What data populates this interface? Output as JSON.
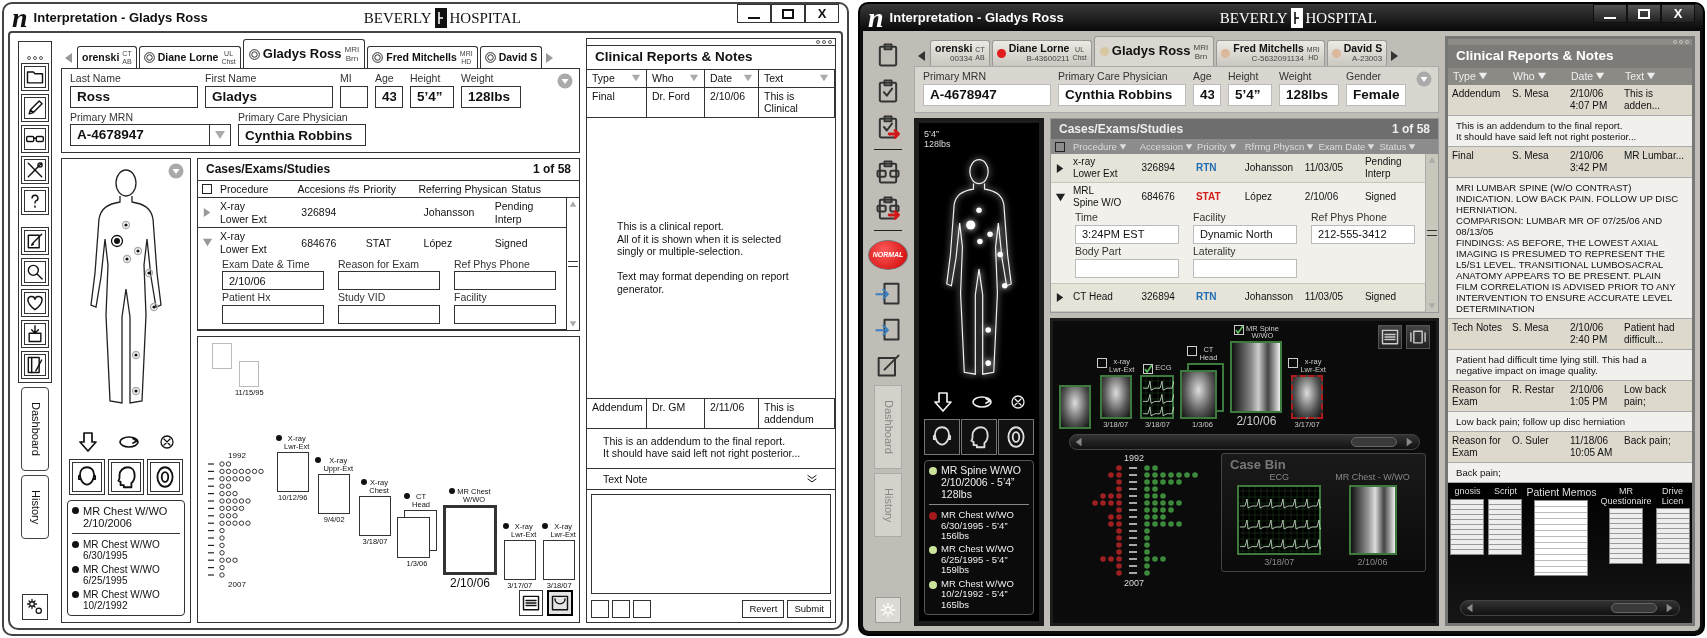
{
  "windows": [
    {
      "kind": "wireframe",
      "logo": "n",
      "title": "Interpretation - Gladys Ross",
      "brand": [
        "BEVERLY",
        "HOSPITAL"
      ],
      "close_label": "X",
      "toolbar": {
        "sidebar_tabs": [
          {
            "label": "Dashboard",
            "selected": false
          },
          {
            "label": "History",
            "selected": false
          }
        ]
      },
      "patient_tabs": [
        {
          "name": "orenski",
          "modality": "CT",
          "region": "AB",
          "selected": false
        },
        {
          "name": "Diane Lorne",
          "modality": "UL",
          "region": "Chst",
          "radio": true,
          "selected": false
        },
        {
          "name": "Gladys Ross",
          "modality": "MRI",
          "region": "Brn",
          "radio": true,
          "selected": true
        },
        {
          "name": "Fred Mitchells",
          "modality": "MRI",
          "region": "HD",
          "radio": true,
          "selected": false
        },
        {
          "name": "David S",
          "radio": true,
          "selected": false
        }
      ],
      "demographics": [
        [
          {
            "label": "Last Name",
            "value": "Ross",
            "kind": "text"
          },
          {
            "label": "First Name",
            "value": "Gladys",
            "kind": "text"
          },
          {
            "label": "MI",
            "kind": "short"
          },
          {
            "label": "Age",
            "value": "43",
            "kind": "short"
          },
          {
            "label": "Height",
            "value": "5’4”",
            "kind": "short"
          },
          {
            "label": "Weight",
            "value": "128lbs",
            "kind": "short"
          }
        ],
        [
          {
            "label": "Primary MRN",
            "value": "A-4678947",
            "kind": "dropdown"
          },
          {
            "label": "Primary Care Physician",
            "value": "Cynthia Robbins",
            "kind": "text"
          }
        ]
      ],
      "body_panel": {
        "studies": [
          {
            "title": "MR Chest W/WO",
            "detail": "2/10/2006",
            "current": true
          },
          {
            "title": "MR Chest W/WO",
            "detail": "6/30/1995",
            "current": false
          },
          {
            "title": "MR Chest W/WO",
            "detail": "6/25/1995",
            "current": false
          },
          {
            "title": "MR Chest W/WO",
            "detail": "10/2/1992",
            "current": false
          }
        ]
      },
      "cases": {
        "title": "Cases/Exams/Studies",
        "count": "1 of 58",
        "select_all": false,
        "columns": [
          {
            "label": "Procedure"
          },
          {
            "label": "Accesions #s"
          },
          {
            "label": "Priority"
          },
          {
            "label": "Referring Physican"
          },
          {
            "label": "Status"
          }
        ],
        "rows": [
          {
            "expanded": false,
            "cells": [
              "X-ray\nLower Ext",
              "326894",
              null,
              "Johansson",
              "Pending\nInterp"
            ]
          },
          {
            "expanded": true,
            "cells": [
              "X-ray\nLower Ext",
              "684676",
              "STAT",
              "López",
              "Signed"
            ],
            "details": [
              {
                "label": "Exam Date & Time",
                "value": "2/10/06"
              },
              {
                "label": "Reason for Exam"
              },
              {
                "label": "Ref Phys Phone"
              },
              {
                "label": "Patient Hx"
              },
              {
                "label": "Study VID"
              },
              {
                "label": "Facility"
              }
            ]
          }
        ]
      },
      "timeline": {
        "years": [
          "1992",
          "2007"
        ],
        "studies": [
          {
            "faded": true,
            "selected": false
          },
          {
            "date": "11/15/95",
            "faded": true,
            "selected": false
          },
          {
            "label": "X-ray\nLwr-Ext",
            "date": "10/12/96",
            "selected": false
          },
          {
            "label": "X-ray\nUppr-Ext",
            "date": "9/4/02",
            "selected": false
          },
          {
            "label": "X-ray\nChest",
            "date": "3/18/07",
            "selected": false
          },
          {
            "label": "CT\nHead",
            "date": "1/3/06",
            "stack": true,
            "selected": false
          },
          {
            "label": "MR Chest\nW/WO",
            "date": "2/10/06",
            "selected": true
          },
          {
            "label": "X-ray\nLwr-Ext",
            "date": "3/17/07",
            "selected": false
          },
          {
            "label": "X-ray\nLwr-Ext",
            "date": "3/18/07",
            "selected": false
          }
        ],
        "view_buttons": [
          {
            "selected": false
          },
          {
            "selected": true
          }
        ]
      },
      "reports": {
        "title": "Clinical Reports & Notes",
        "columns": [
          {
            "label": "Type",
            "sortable": true
          },
          {
            "label": "Who",
            "sortable": true
          },
          {
            "label": "Date",
            "sortable": true
          },
          {
            "label": "Text",
            "sortable": true
          }
        ],
        "entries": [
          {
            "type": "Final",
            "who": "Dr. Ford",
            "date": "2/10/06",
            "text": "This is Clinical",
            "body": "This is a clinical report.\nAll of it is shown when it is selected\nsingly or multiple-selection.\n\nText may format depending on report\ngenerator."
          },
          {
            "type": "Addendum",
            "who": "Dr. GM",
            "date": "2/11/06",
            "text": "This is addendum",
            "body": "This is an addendum to the final report.\nIt should have said left not right posterior..."
          }
        ],
        "note": {
          "label": "Text Note",
          "actions": [
            "Revert",
            "Submit"
          ]
        }
      }
    },
    {
      "kind": "rendered",
      "logo": "n",
      "title": "Interpretation - Gladys Ross",
      "brand": [
        "BEVERLY",
        "HOSPITAL"
      ],
      "close_label": "X",
      "toolbar": {
        "status_button": "NORMAL",
        "sidebar_tabs": [
          {
            "label": "Dashboard",
            "selected": false
          },
          {
            "label": "History",
            "selected": false
          }
        ]
      },
      "patient_tabs": [
        {
          "name": "orenski",
          "modality": "CT",
          "region": "AB",
          "mrn": "00334",
          "selected": false
        },
        {
          "name": "Diane Lorne",
          "modality": "UL",
          "region": "Chst",
          "mrn": "B-43600211",
          "color": "#e01c1c",
          "selected": false
        },
        {
          "name": "Gladys Ross",
          "modality": "MRI",
          "region": "Brn",
          "color": "#d9c7a3",
          "selected": true
        },
        {
          "name": "Fred Mitchells",
          "modality": "MRI",
          "region": "HD",
          "mrn": "C-5632091134",
          "color": "#dcb89c",
          "selected": false
        },
        {
          "name": "David S",
          "mrn": "A-23003",
          "color": "#dcb89c",
          "selected": false
        }
      ],
      "demographics": [
        [
          {
            "label": "Primary MRN",
            "value": "A-4678947",
            "kind": "text"
          },
          {
            "label": "Primary Care Physician",
            "value": "Cynthia Robbins",
            "kind": "text"
          },
          {
            "label": "Age",
            "value": "43",
            "kind": "short"
          },
          {
            "label": "Height",
            "value": "5’4”",
            "kind": "short"
          },
          {
            "label": "Weight",
            "value": "128lbs",
            "kind": "short"
          },
          {
            "label": "Gender",
            "value": "Female",
            "kind": "short"
          }
        ]
      ],
      "body_panel": {
        "stats": [
          "5’4”",
          "128lbs"
        ],
        "studies": [
          {
            "title": "MR Spine W/WO",
            "detail": "2/10/2006 - 5’4” 128lbs",
            "current": true,
            "color": "#c9e39b"
          },
          {
            "title": "MR Chest W/WO",
            "detail": "6/30/1995 - 5’4” 156lbs",
            "current": false,
            "color": "#a11b1b"
          },
          {
            "title": "MR Chest W/WO",
            "detail": "6/25/1995 - 5’4” 159lbs",
            "current": false,
            "color": "#c9e39b"
          },
          {
            "title": "MR Chest W/WO",
            "detail": "10/2/1992 - 5’4” 165lbs",
            "current": false,
            "color": "#c9e39b"
          }
        ]
      },
      "cases": {
        "title": "Cases/Exams/Studies",
        "count": "1 of 58",
        "select_all": false,
        "columns": [
          {
            "label": "Procedure",
            "sortable": true
          },
          {
            "label": "Accession",
            "sortable": true
          },
          {
            "label": "Priority",
            "sortable": true
          },
          {
            "label": "Rfrmg Physcn",
            "sortable": true
          },
          {
            "label": "Exam Date",
            "sortable": true
          },
          {
            "label": "Status",
            "sortable": true
          }
        ],
        "rows": [
          {
            "expanded": false,
            "color": "#1f6fb5",
            "cells": [
              "x-ray\nLower Ext",
              "326894",
              "RTN",
              "Johansson",
              "11/03/05",
              "Pending\nInterp"
            ]
          },
          {
            "expanded": true,
            "color": "#d41a1a",
            "cells": [
              "MRL\nSpine W/O",
              "684676",
              "STAT",
              "López",
              "2/10/06",
              "Signed"
            ],
            "details": [
              {
                "label": "Time",
                "value": "3:24PM EST"
              },
              {
                "label": "Facility",
                "value": "Dynamic North"
              },
              {
                "label": "Ref Phys Phone",
                "value": "212-555-3412"
              },
              {
                "label": "Body Part"
              },
              {
                "label": "Laterality"
              }
            ]
          },
          {
            "expanded": false,
            "color": "#1f6fb5",
            "cells": [
              "CT Head",
              "326894",
              "RTN",
              "Johansson",
              "11/03/05",
              "Signed"
            ]
          }
        ]
      },
      "timeline": {
        "years": [
          "1992",
          "2007"
        ],
        "studies": [
          {
            "kind": "image",
            "flagged": false,
            "selected": false
          },
          {
            "kind": "image",
            "label": "x-ray\nLwr-Ext",
            "date": "3/18/07",
            "checked": false,
            "flagged": false,
            "selected": false
          },
          {
            "kind": "ecg",
            "label": "ECG",
            "date": "3/18/07",
            "checked": true,
            "flagged": false,
            "selected": false
          },
          {
            "kind": "image",
            "label": "CT\nHead",
            "date": "1/3/06",
            "checked": false,
            "stack": true,
            "flagged": false,
            "selected": false
          },
          {
            "kind": "image",
            "label": "MR Spine\nW/WO",
            "date": "2/10/06",
            "checked": true,
            "flagged": false,
            "selected": true
          },
          {
            "kind": "image",
            "label": "x-ray\nLwr-Ext",
            "date": "3/17/07",
            "checked": false,
            "flagged": true,
            "selected": false
          }
        ],
        "view_buttons": [
          {
            "selected": false
          },
          {
            "selected": false
          }
        ],
        "case_bin": {
          "title": "Case Bin",
          "items": [
            {
              "kind": "ecg",
              "label": "ECG",
              "date": "3/18/07"
            },
            {
              "kind": "image",
              "label": "MR Chest - W/WO",
              "date": "2/10/06"
            }
          ]
        }
      },
      "reports": {
        "title": "Clinical Reports & Notes",
        "columns": [
          {
            "label": "Type",
            "sortable": true
          },
          {
            "label": "Who",
            "sortable": true
          },
          {
            "label": "Date",
            "sortable": true
          },
          {
            "label": "Text",
            "sortable": true
          }
        ],
        "entries": [
          {
            "type": "Addendum",
            "who": "S. Mesa",
            "date": "2/10/06",
            "time": "4:07 PM",
            "text": "This is adden...",
            "body": "This is an addendum to the final report.\nIt should have said left not right posterior..."
          },
          {
            "type": "Final",
            "who": "S. Mesa",
            "date": "2/10/06",
            "time": "3:42 PM",
            "text": "MR Lumbar...",
            "body": "MRI LUMBAR SPINE (W/O CONTRAST)\nINDICATION. LOW BACK PAIN. FOLLOW UP DISC HERNIATION.\nCOMPARISON: LUMBAR MR OF 07/25/06 AND 08/13/05\nFINDINGS: AS BEFORE, THE LOWEST AXIAL IMAGING IS PRESUMED TO REPRESENT THE L5/S1 LEVEL. TRANSITIONAL LUMBOSACRAL ANATOMY APPEARS TO BE PRESENT. PLAIN FILM CORRELATION IS ADVISED PRIOR TO ANY INTERVENTION TO ENSURE ACCURATE LEVEL DETERMINATION"
          },
          {
            "type": "Tech Notes",
            "who": "S. Mesa",
            "date": "2/10/06",
            "time": "2:40 PM",
            "text": "Patient had difficult...",
            "body": "Patient had difficult time lying still. This had a negative impact on image quality."
          },
          {
            "type": "Reason for Exam",
            "who": "R. Restar",
            "date": "2/10/06",
            "time": "1:05 PM",
            "text": "Low back pain;",
            "body": "Low back pain; follow up disc herniation"
          },
          {
            "type": "Reason for Exam",
            "who": "O. Suler",
            "date": "11/18/06",
            "time": "10:05 AM",
            "text": "Back pain;",
            "body": "Back pain;"
          }
        ],
        "memos": {
          "items": [
            {
              "label": "gnosis",
              "selected": false
            },
            {
              "label": "Script",
              "selected": false
            },
            {
              "label": "Patient Memos",
              "selected": true
            },
            {
              "label": "MR\nQuestionaire",
              "selected": false
            },
            {
              "label": "Drive\nLicen",
              "selected": false
            }
          ]
        }
      }
    }
  ]
}
